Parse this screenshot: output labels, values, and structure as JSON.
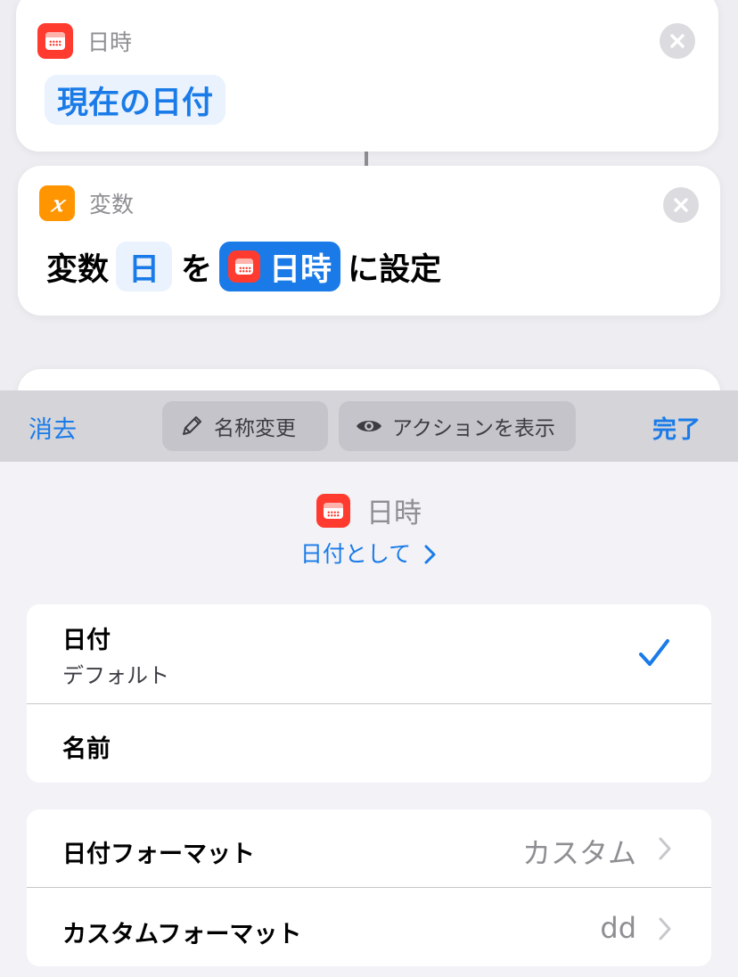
{
  "card_date": {
    "header_label": "日時",
    "token": "現在の日付"
  },
  "card_variable": {
    "header_label": "変数",
    "icon_glyph": "𝑥",
    "word_variable": "変数",
    "var_name": "日",
    "particle": "を",
    "date_token": "日時",
    "suffix": "に設定"
  },
  "toolbar": {
    "clear": "消去",
    "rename": "名称変更",
    "show_actions": "アクションを表示",
    "done": "完了"
  },
  "sheet": {
    "title": "日時",
    "subtitle": "日付として",
    "options": [
      {
        "title": "日付",
        "subtitle": "デフォルト",
        "checked": true
      },
      {
        "title": "名前"
      }
    ],
    "settings": [
      {
        "label": "日付フォーマット",
        "value": "カスタム"
      },
      {
        "label": "カスタムフォーマット",
        "value": "dd"
      }
    ]
  },
  "colors": {
    "accent": "#1a7be8",
    "calendar_icon": "#ff3b30",
    "variable_icon": "#ff9500"
  }
}
